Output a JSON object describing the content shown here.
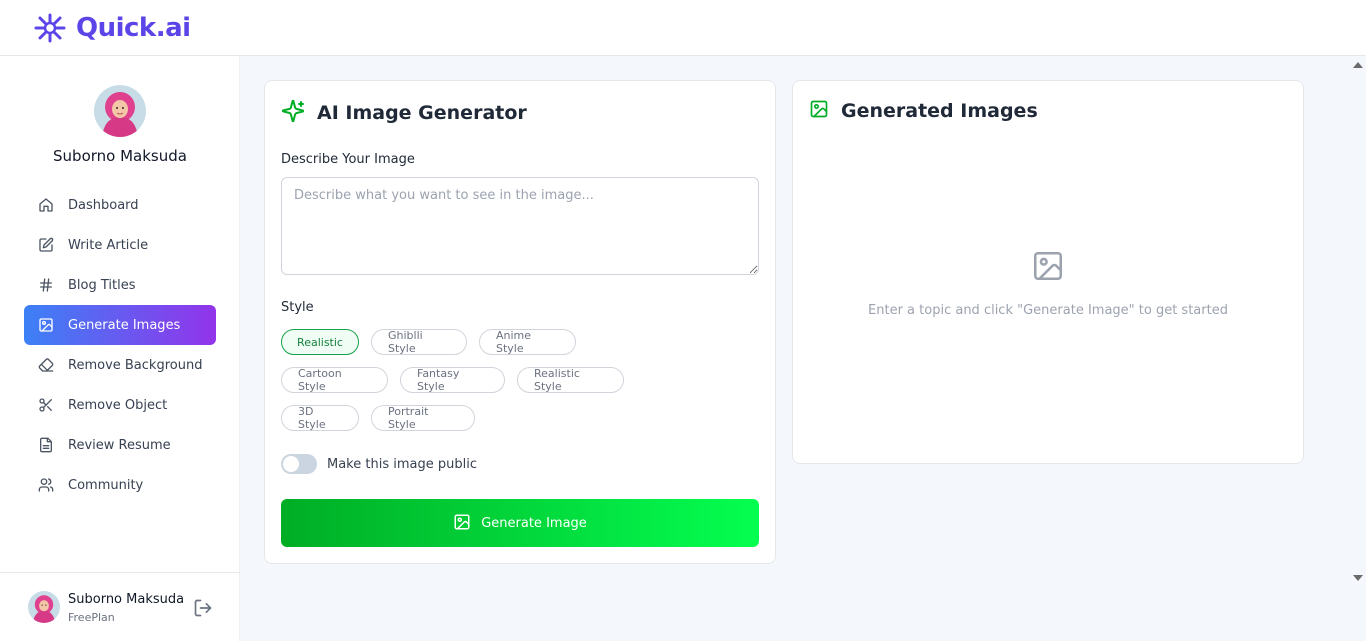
{
  "app": {
    "name": "Quick.ai",
    "brand_color": "#5b45e8"
  },
  "user": {
    "name": "Suborno Maksuda",
    "plan": "FreePlan"
  },
  "sidebar": {
    "items": [
      {
        "label": "Dashboard",
        "icon": "house-icon",
        "active": false
      },
      {
        "label": "Write Article",
        "icon": "square-pen-icon",
        "active": false
      },
      {
        "label": "Blog Titles",
        "icon": "hash-icon",
        "active": false
      },
      {
        "label": "Generate Images",
        "icon": "image-icon",
        "active": true
      },
      {
        "label": "Remove Background",
        "icon": "eraser-icon",
        "active": false
      },
      {
        "label": "Remove Object",
        "icon": "scissors-icon",
        "active": false
      },
      {
        "label": "Review Resume",
        "icon": "file-text-icon",
        "active": false
      },
      {
        "label": "Community",
        "icon": "users-icon",
        "active": false
      }
    ],
    "active_gradient": [
      "#3c81f6",
      "#9234ea"
    ]
  },
  "generator": {
    "title": "AI Image Generator",
    "describe_label": "Describe Your Image",
    "describe_placeholder": "Describe what you want to see in the image...",
    "describe_value": "",
    "style_label": "Style",
    "styles": [
      "Realistic",
      "Ghiblli Style",
      "Anime Style",
      "Cartoon Style",
      "Fantasy Style",
      "Realistic Style",
      "3D Style",
      "Portrait Style"
    ],
    "selected_style": "Realistic",
    "public_toggle_label": "Make this image public",
    "public_toggle_on": false,
    "button_label": "Generate Image",
    "accent_color": "#00ad25"
  },
  "results": {
    "title": "Generated Images",
    "empty_text": "Enter a topic and click \"Generate Image\" to get started"
  }
}
